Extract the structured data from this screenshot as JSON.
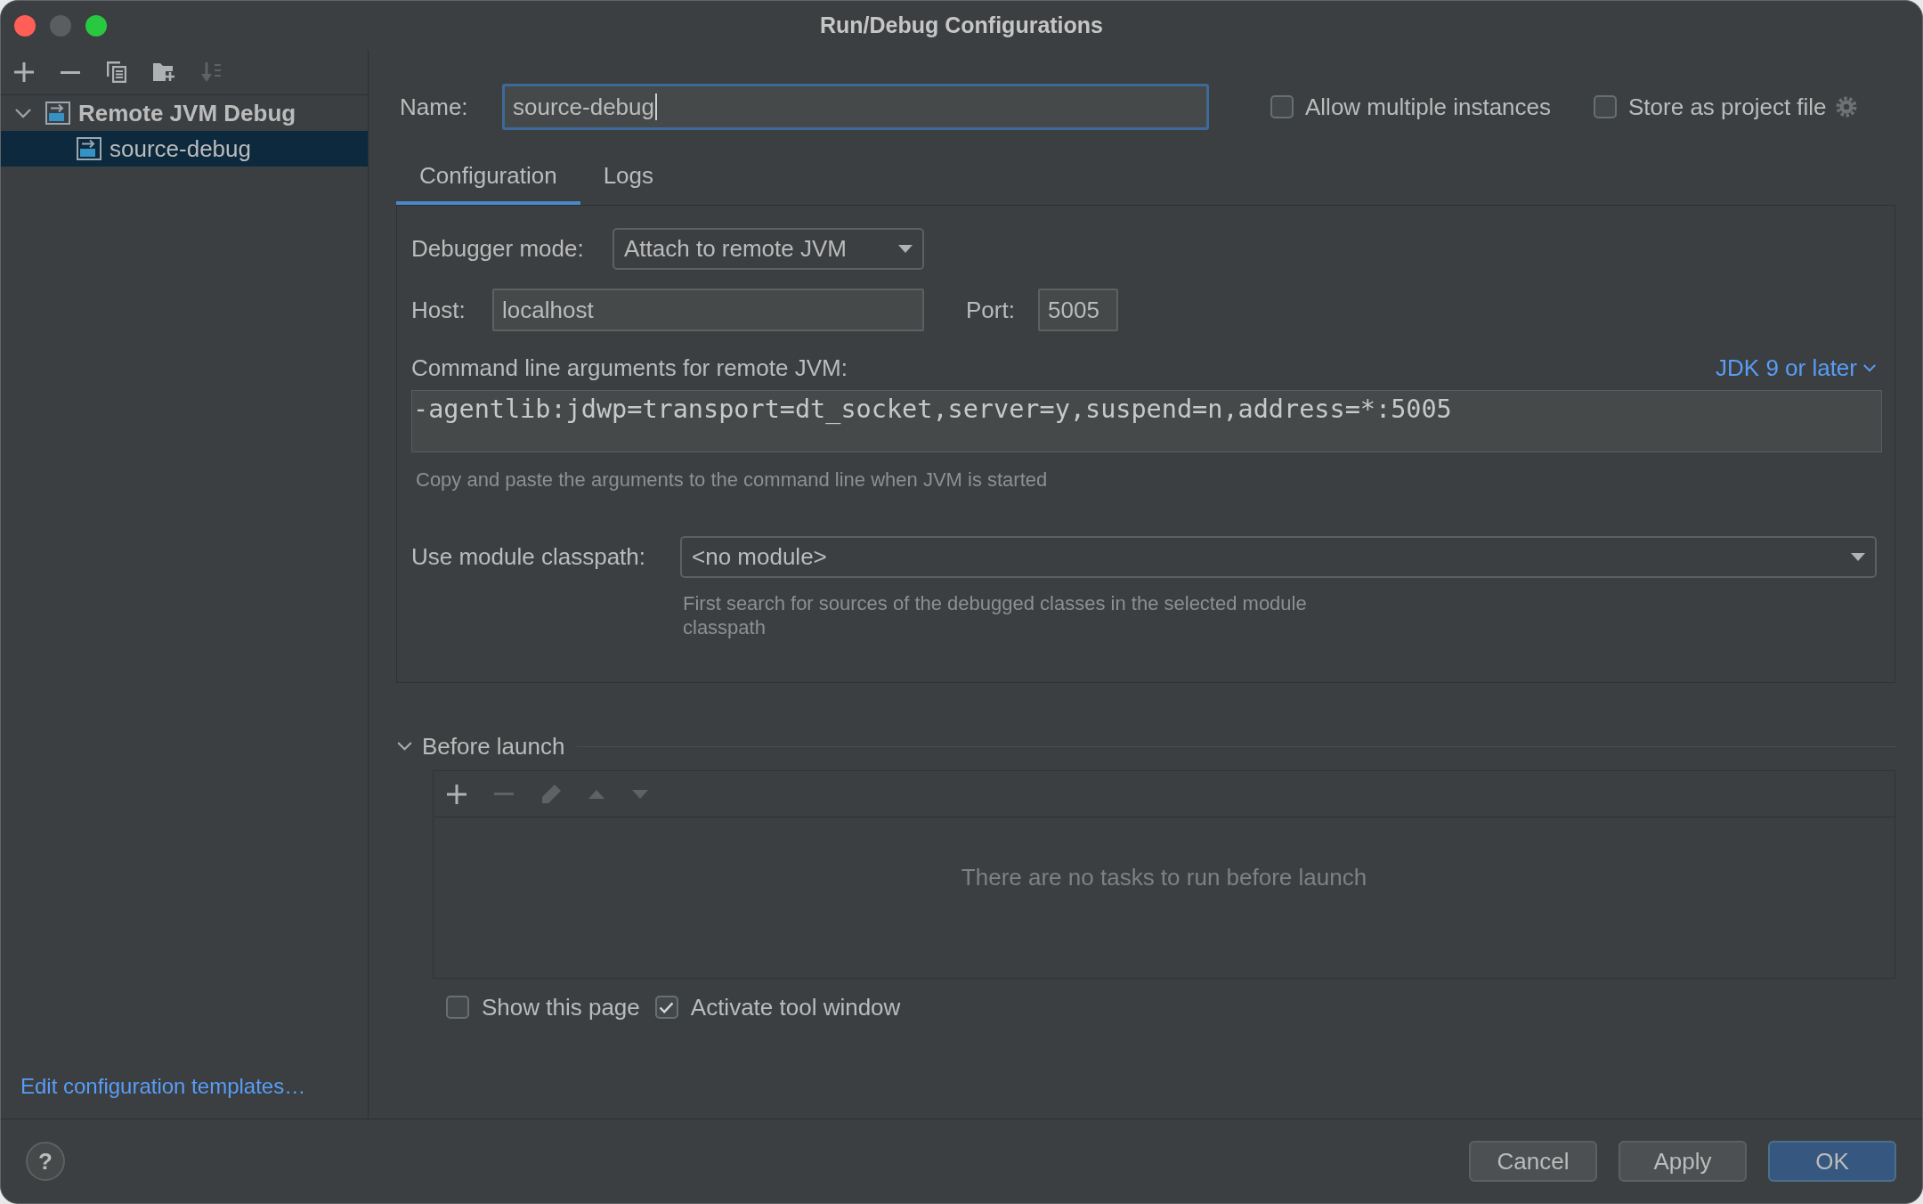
{
  "window": {
    "title": "Run/Debug Configurations",
    "controls": [
      {
        "kind": "close",
        "disabled": false
      },
      {
        "kind": "minimize",
        "disabled": true
      },
      {
        "kind": "zoom",
        "disabled": false
      }
    ]
  },
  "sidebar": {
    "toolbar": [
      {
        "kind": "add",
        "disabled": false
      },
      {
        "kind": "remove",
        "disabled": false
      },
      {
        "kind": "copy",
        "disabled": false
      },
      {
        "kind": "folder_add",
        "disabled": false
      },
      {
        "kind": "sort",
        "disabled": true
      }
    ],
    "tree": [
      {
        "label": "Remote JVM Debug",
        "selected": false,
        "expanded": true,
        "children": [
          {
            "label": "source-debug",
            "selected": true
          }
        ]
      }
    ],
    "templates_link": "Edit configuration templates…"
  },
  "name_field": {
    "label": "Name:",
    "value": "source-debug",
    "focused": true
  },
  "options": [
    {
      "label": "Allow multiple instances",
      "checked": false
    },
    {
      "label": "Store as project file",
      "checked": false
    }
  ],
  "tabs": [
    {
      "label": "Configuration",
      "selected": true
    },
    {
      "label": "Logs",
      "selected": false
    }
  ],
  "configuration": {
    "debugger_mode": {
      "label": "Debugger mode:",
      "value": "Attach to remote JVM"
    },
    "host": {
      "label": "Host:",
      "value": "localhost"
    },
    "port": {
      "label": "Port:",
      "value": "5005"
    },
    "command_line": {
      "label": "Command line arguments for remote JVM:",
      "jdk_link": "JDK 9 or later",
      "value": "-agentlib:jdwp=transport=dt_socket,server=y,suspend=n,address=*:5005",
      "hint": "Copy and paste the arguments to the command line when JVM is started"
    },
    "module_classpath": {
      "label": "Use module classpath:",
      "value": "<no module>",
      "hint": "First search for sources of the debugged classes in the selected module classpath"
    }
  },
  "before_launch": {
    "title": "Before launch",
    "expanded": true,
    "toolbar": [
      {
        "kind": "add",
        "disabled": false
      },
      {
        "kind": "remove",
        "disabled": true
      },
      {
        "kind": "edit",
        "disabled": true
      },
      {
        "kind": "move_up",
        "disabled": true
      },
      {
        "kind": "move_down",
        "disabled": true
      }
    ],
    "empty_text": "There are no tasks to run before launch",
    "options": [
      {
        "label": "Show this page",
        "checked": false
      },
      {
        "label": "Activate tool window",
        "checked": true
      }
    ]
  },
  "help_button": "?",
  "buttons": [
    {
      "label": "Cancel",
      "default": false
    },
    {
      "label": "Apply",
      "default": false
    },
    {
      "label": "OK",
      "default": true
    }
  ]
}
